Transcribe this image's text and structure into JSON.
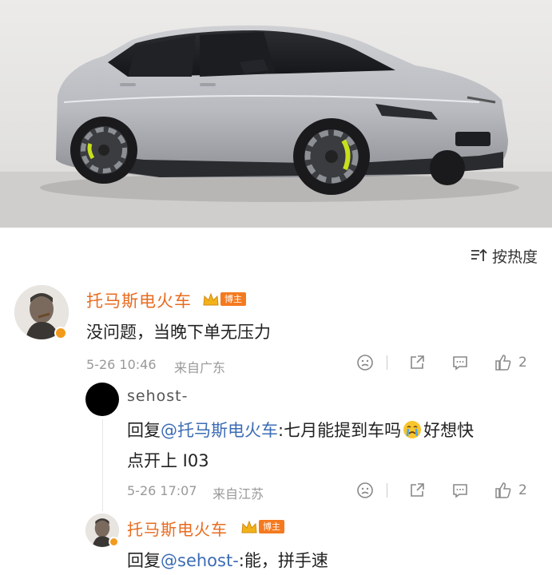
{
  "sort": {
    "label": "按热度"
  },
  "comment": {
    "author": "托马斯电火车",
    "badge": "博主",
    "text": "没问题，当晚下单无压力",
    "time": "5-26 10:46",
    "location": "来自广东",
    "likes": "2"
  },
  "reply1": {
    "author": "sehost-",
    "prefix": "回复",
    "mention": "@托马斯电火车",
    "text_line1": ":七月能提到车吗",
    "text_line1_end": "好想快",
    "text_line2": "点开上 I03",
    "time": "5-26 17:07",
    "location": "来自江苏",
    "likes": "2"
  },
  "reply2": {
    "author": "托马斯电火车",
    "badge": "博主",
    "prefix": "回复",
    "mention": "@sehost-",
    "text": ":能，拼手速"
  },
  "colors": {
    "accent_name": "#e86b1f",
    "mention": "#3c6cb5",
    "badge": "#f47a20"
  }
}
